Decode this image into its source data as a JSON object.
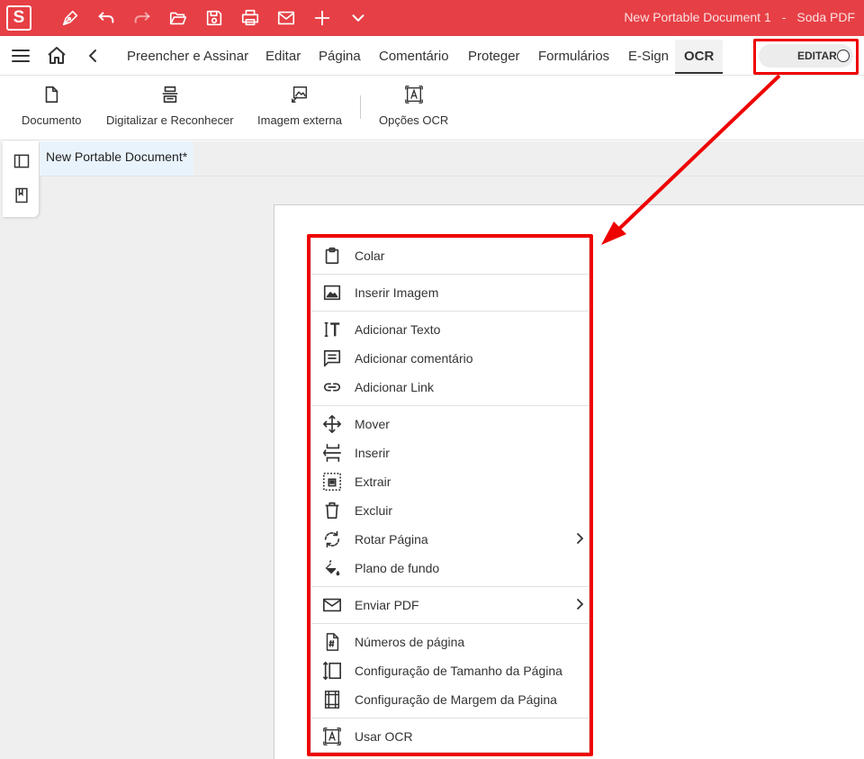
{
  "app": {
    "logo_letter": "S",
    "document_title": "New Portable Document 1",
    "title_separator": "-",
    "app_name": "Soda PDF",
    "accent": "#e63f45",
    "highlight": "#e00000"
  },
  "quick_toolbar": {
    "icons": [
      "pen-icon",
      "undo-icon",
      "redo-icon",
      "folder-open-icon",
      "save-icon",
      "print-icon",
      "mail-icon",
      "plus-icon",
      "chevron-down-icon"
    ]
  },
  "menubar": {
    "tabs": [
      {
        "label": "Preencher e Assinar"
      },
      {
        "label": "Editar"
      },
      {
        "label": "Página"
      },
      {
        "label": "Comentário"
      },
      {
        "label": "Proteger"
      },
      {
        "label": "Formulários"
      },
      {
        "label": "E-Sign"
      },
      {
        "label": "OCR",
        "active": true
      }
    ],
    "edit_toggle_label": "EDITAR"
  },
  "ribbon": {
    "buttons": [
      {
        "label": "Documento",
        "icon": "document-icon"
      },
      {
        "label": "Digitalizar e Reconhecer",
        "icon": "scanner-icon"
      },
      {
        "label": "Imagem externa",
        "icon": "image-import-icon"
      },
      {
        "label": "Opções OCR",
        "icon": "ocr-icon"
      }
    ]
  },
  "document_tab": {
    "label": "New Portable Document*"
  },
  "context_menu": {
    "items": [
      {
        "label": "Colar",
        "icon": "clipboard-icon"
      },
      {
        "label": "Inserir Imagem",
        "icon": "image-icon"
      },
      {
        "label": "Adicionar Texto",
        "icon": "text-icon"
      },
      {
        "label": "Adicionar comentário",
        "icon": "comment-icon"
      },
      {
        "label": "Adicionar Link",
        "icon": "link-icon"
      },
      {
        "label": "Mover",
        "icon": "move-icon"
      },
      {
        "label": "Inserir",
        "icon": "insert-icon"
      },
      {
        "label": "Extrair",
        "icon": "extract-icon"
      },
      {
        "label": "Excluir",
        "icon": "trash-icon"
      },
      {
        "label": "Rotar Página",
        "icon": "rotate-icon",
        "submenu": true
      },
      {
        "label": "Plano de fundo",
        "icon": "paint-bucket-icon"
      },
      {
        "label": "Enviar PDF",
        "icon": "mail-icon",
        "submenu": true
      },
      {
        "label": "Números de página",
        "icon": "page-number-icon"
      },
      {
        "label": "Configuração de Tamanho da Página",
        "icon": "page-size-icon"
      },
      {
        "label": "Configuração de Margem da Página",
        "icon": "page-margin-icon"
      },
      {
        "label": "Usar OCR",
        "icon": "ocr-icon"
      }
    ]
  }
}
